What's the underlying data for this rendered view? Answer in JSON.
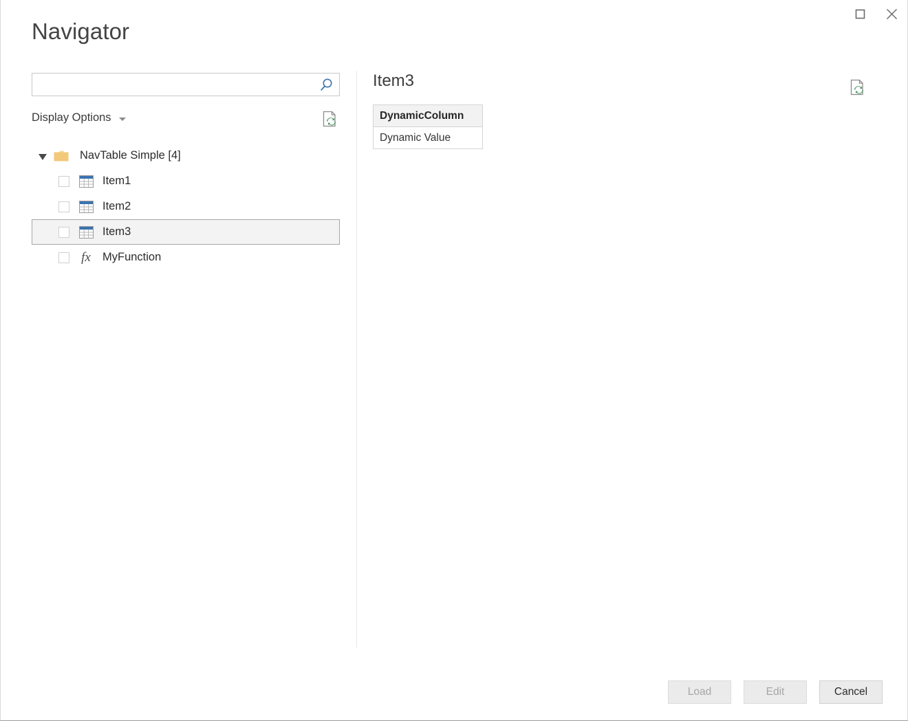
{
  "window": {
    "title": "Navigator",
    "controls": [
      {
        "name": "maximize",
        "icon": "maximize-icon"
      },
      {
        "name": "close",
        "icon": "close-icon"
      }
    ]
  },
  "search": {
    "value": "",
    "placeholder": "",
    "icon": "search-icon"
  },
  "display_options": {
    "label": "Display Options",
    "caret_icon": "chevron-down-icon"
  },
  "refresh": {
    "left_icon": "refresh-page-icon",
    "right_icon": "refresh-page-icon"
  },
  "tree": {
    "root": {
      "label": "NavTable Simple [4]",
      "expanded": true,
      "icon": "folder-icon"
    },
    "items": [
      {
        "label": "Item1",
        "icon": "table-icon",
        "checked": false,
        "selected": false
      },
      {
        "label": "Item2",
        "icon": "table-icon",
        "checked": false,
        "selected": false
      },
      {
        "label": "Item3",
        "icon": "table-icon",
        "checked": false,
        "selected": true
      },
      {
        "label": "MyFunction",
        "icon": "function-icon",
        "glyph": "fx",
        "checked": false,
        "selected": false
      }
    ]
  },
  "preview": {
    "title": "Item3",
    "columns": [
      "DynamicColumn"
    ],
    "rows": [
      [
        "Dynamic Value"
      ]
    ]
  },
  "footer": {
    "buttons": [
      {
        "label": "Load",
        "enabled": false
      },
      {
        "label": "Edit",
        "enabled": false
      },
      {
        "label": "Cancel",
        "enabled": true
      }
    ]
  },
  "colors": {
    "accent": "#3b74b0",
    "folder": "#f2c87a",
    "refresh_green": "#4f9c6b",
    "selection_bg": "#f3f3f3",
    "selection_border": "#a6a6a6"
  }
}
